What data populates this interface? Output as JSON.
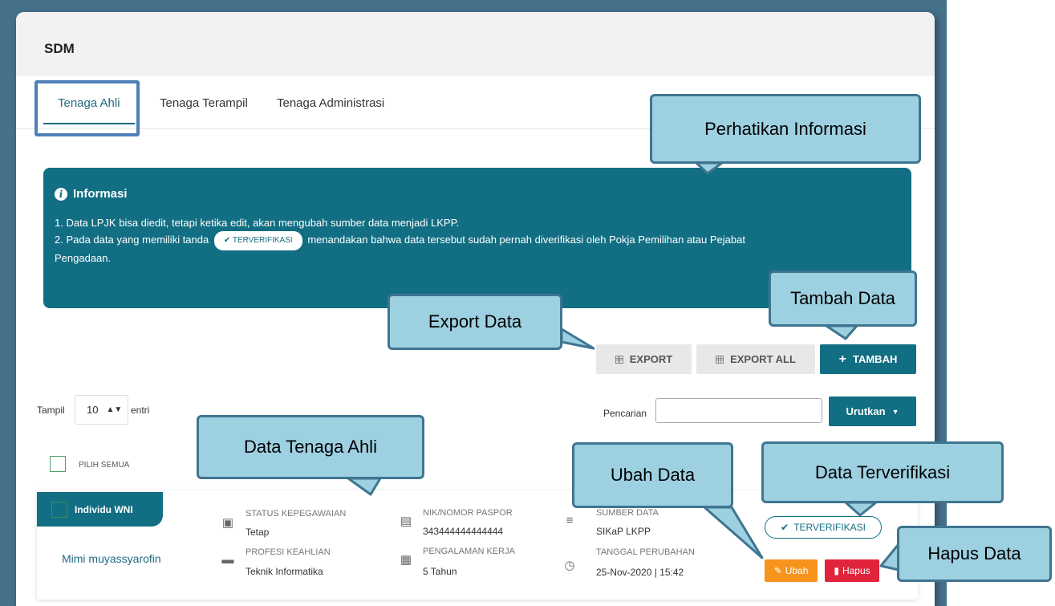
{
  "panel": {
    "title": "SDM"
  },
  "tabs": [
    {
      "label": "Tenaga Ahli",
      "active": true
    },
    {
      "label": "Tenaga Terampil",
      "active": false
    },
    {
      "label": "Tenaga Administrasi",
      "active": false
    }
  ],
  "info": {
    "title": "Informasi",
    "line1": "1. Data LPJK bisa diedit, tetapi ketika edit, akan mengubah sumber data menjadi LKPP.",
    "line2_prefix": "2. Pada data yang memiliki tanda",
    "line2_badge": "TERVERIFIKASI",
    "line2_suffix": "menandakan bahwa data tersebut sudah pernah diverifikasi oleh Pokja Pemilihan atau Pejabat",
    "line3": "Pengadaan."
  },
  "toolbar": {
    "export_label": "EXPORT",
    "export_all_label": "EXPORT ALL",
    "add_label": "TAMBAH"
  },
  "table_controls": {
    "show_label": "Tampil",
    "page_size": "10",
    "entries_label": "entri",
    "search_label": "Pencarian",
    "search_value": "",
    "sort_label": "Urutkan",
    "select_all_label": "PILIH SEMUA"
  },
  "record": {
    "type_tag": "Individu WNI",
    "name": "Mimi muyassyarofin",
    "status_label": "STATUS KEPEGAWAIAN",
    "status_value": "Tetap",
    "profession_label": "PROFESI KEAHLIAN",
    "profession_value": "Teknik Informatika",
    "nik_label": "NIK/NOMOR PASPOR",
    "nik_value": "343444444444444",
    "experience_label": "PENGALAMAN KERJA",
    "experience_value": "5 Tahun",
    "source_label": "SUMBER DATA",
    "source_value": "SIKaP LKPP",
    "date_label": "TANGGAL PERUBAHAN",
    "date_value": "25-Nov-2020 | 15:42",
    "verified_label": "TERVERIFIKASI",
    "edit_label": "Ubah",
    "delete_label": "Hapus"
  },
  "callouts": {
    "info": "Perhatikan Informasi",
    "add": "Tambah Data",
    "export": "Export Data",
    "list": "Data Tenaga Ahli",
    "edit": "Ubah Data",
    "verified": "Data Terverifikasi",
    "delete": "Hapus Data"
  },
  "colors": {
    "accent": "#126e83",
    "edit": "#f7941d",
    "delete": "#e0243b",
    "callout_fill": "#9dd0e1",
    "callout_border": "#3f7590"
  }
}
